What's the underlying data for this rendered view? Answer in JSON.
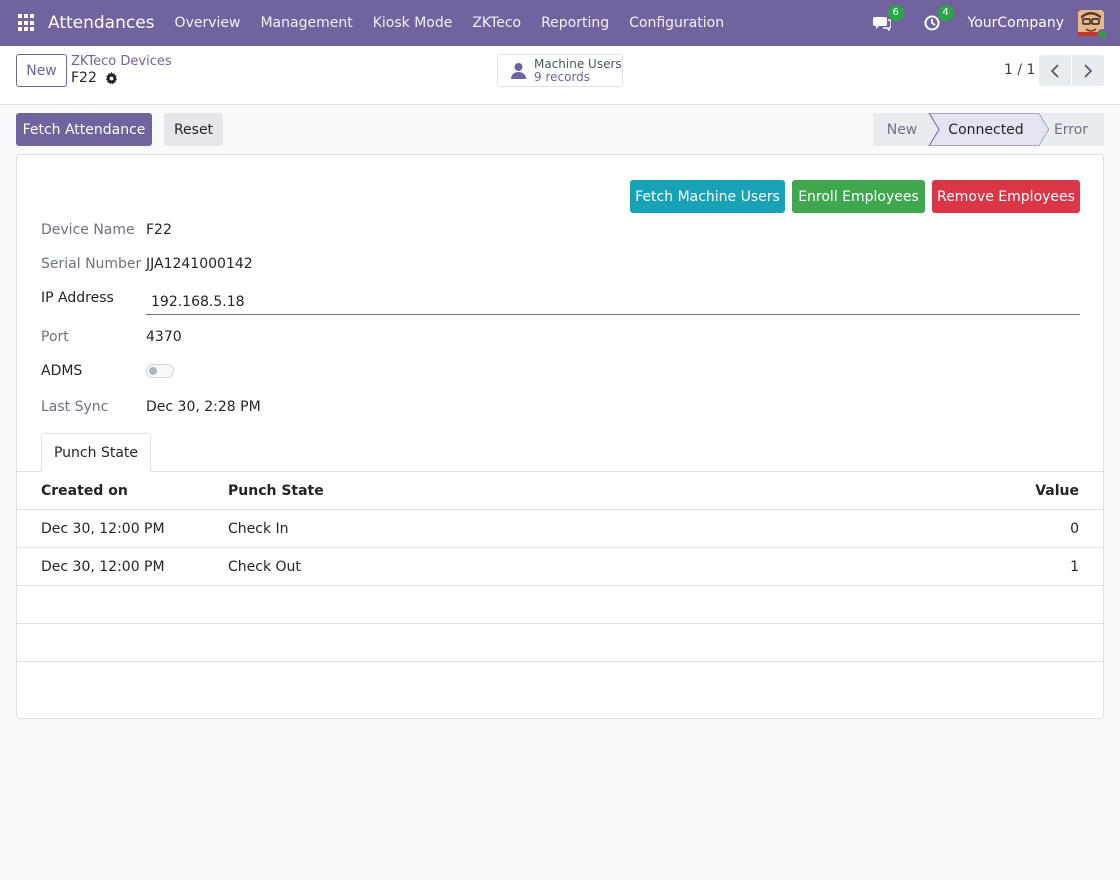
{
  "navbar": {
    "app_title": "Attendances",
    "menu": [
      "Overview",
      "Management",
      "Kiosk Mode",
      "ZKTeco",
      "Reporting",
      "Configuration"
    ],
    "messages_count": "6",
    "activities_count": "4",
    "company": "YourCompany",
    "color": "#71639e"
  },
  "control_panel": {
    "new_label": "New",
    "breadcrumb_parent": "ZKTeco Devices",
    "record_name": "F22",
    "smart_button": {
      "label": "Machine Users",
      "count": "9 records"
    },
    "pager": "1 / 1"
  },
  "actions": {
    "fetch_attendance": "Fetch Attendance",
    "reset": "Reset"
  },
  "statusbar": {
    "stages": [
      "New",
      "Connected",
      "Error"
    ],
    "active": "Connected"
  },
  "sheet": {
    "buttons": {
      "fetch_machine_users": "Fetch Machine Users",
      "enroll_employees": "Enroll Employees",
      "remove_employees": "Remove Employees"
    },
    "fields": {
      "device_name": {
        "label": "Device Name",
        "value": "F22"
      },
      "serial_number": {
        "label": "Serial Number",
        "value": "JJA1241000142"
      },
      "ip_address": {
        "label": "IP Address",
        "value": "192.168.5.18"
      },
      "port": {
        "label": "Port",
        "value": "4370"
      },
      "adms": {
        "label": "ADMS",
        "value": false
      },
      "last_sync": {
        "label": "Last Sync",
        "value": "Dec 30, 2:28 PM"
      }
    },
    "tab": "Punch State",
    "table": {
      "headers": [
        "Created on",
        "Punch State",
        "Value"
      ],
      "rows": [
        [
          "Dec 30, 12:00 PM",
          "Check In",
          "0"
        ],
        [
          "Dec 30, 12:00 PM",
          "Check Out",
          "1"
        ]
      ]
    }
  }
}
